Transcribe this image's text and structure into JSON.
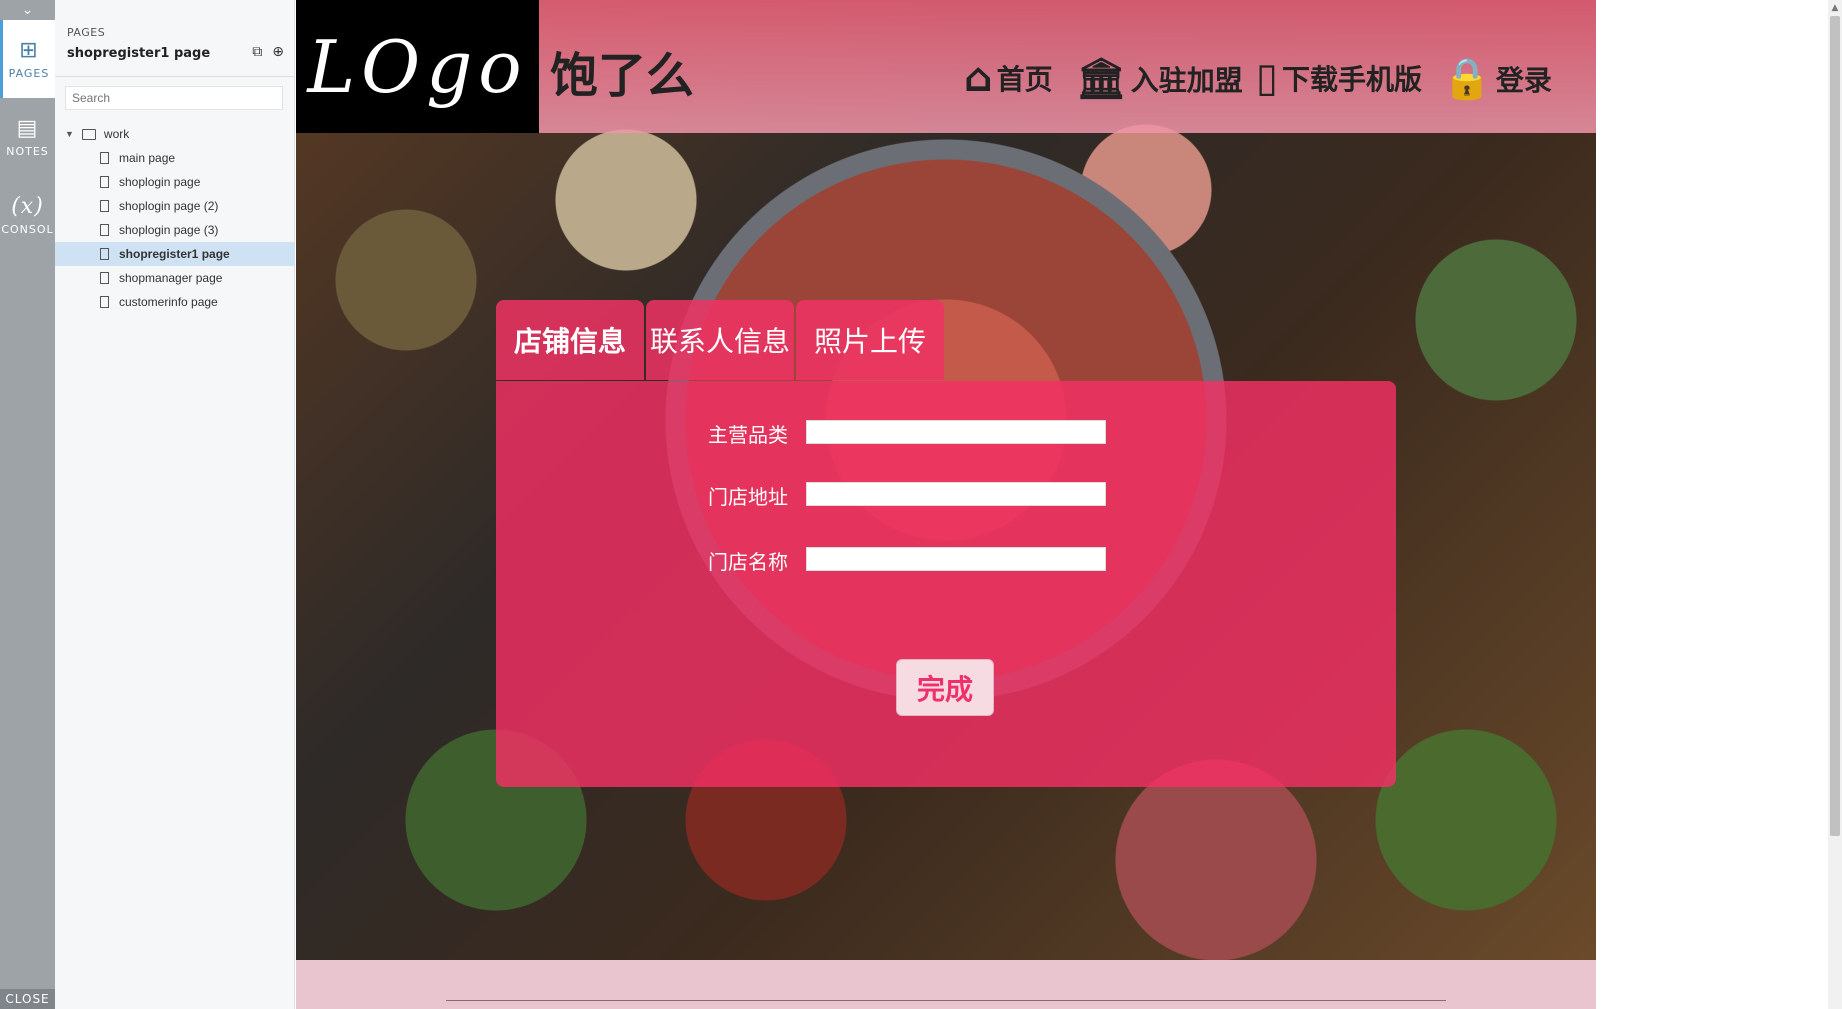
{
  "rail": {
    "items": [
      {
        "label": "PAGES",
        "icon": "sitemap-icon"
      },
      {
        "label": "NOTES",
        "icon": "notes-icon"
      },
      {
        "label": "CONSOL",
        "icon": "variable-icon"
      }
    ],
    "close_label": "CLOSE"
  },
  "pages_panel": {
    "caption": "PAGES",
    "current_page": "shopregister1 page",
    "search_placeholder": "Search",
    "folder": "work",
    "pages": [
      "main page",
      "shoplogin page",
      "shoplogin page (2)",
      "shoplogin page (3)",
      "shopregister1 page",
      "shopmanager page",
      "customerinfo page"
    ],
    "selected_index": 4
  },
  "site": {
    "logo_text": "LOgo",
    "brand": "饱了么",
    "nav": [
      {
        "label": "首页",
        "icon": "home-icon"
      },
      {
        "label": "入驻加盟",
        "icon": "bank-icon"
      },
      {
        "label": "下载手机版",
        "icon": "mobile-icon"
      },
      {
        "label": "登录",
        "icon": "lock-icon"
      }
    ],
    "tabs": [
      "店铺信息",
      "联系人信息",
      "照片上传"
    ],
    "active_tab": 0,
    "form": {
      "fields": [
        {
          "label": "主营品类",
          "value": ""
        },
        {
          "label": "门店地址",
          "value": ""
        },
        {
          "label": "门店名称",
          "value": ""
        }
      ],
      "submit_label": "完成"
    },
    "colors": {
      "accent": "#f0306a",
      "header_bg": "#e86078"
    }
  }
}
